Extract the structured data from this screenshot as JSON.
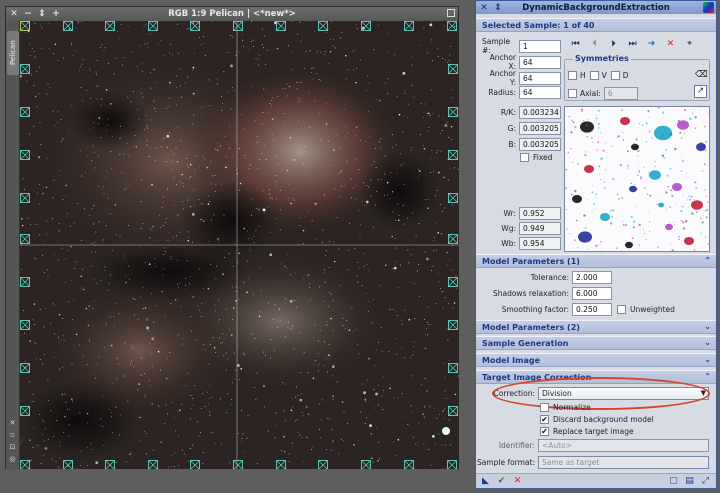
{
  "image_window": {
    "title": "RGB 1:9 Pelican | <*new*>",
    "side_tab": "Pelican",
    "controls": [
      "close-icon",
      "minimize-icon",
      "shade-icon",
      "maximize-icon"
    ]
  },
  "dbe": {
    "title": "DynamicBackgroundExtraction",
    "selected_sample": "Selected Sample: 1 of 40",
    "sample_label": "Sample #:",
    "sample_value": "1",
    "anchor_x_label": "Anchor X:",
    "anchor_x_value": "64",
    "anchor_y_label": "Anchor Y:",
    "anchor_y_value": "64",
    "radius_label": "Radius:",
    "radius_value": "64",
    "symmetries_title": "Symmetries",
    "sym_h": "H",
    "sym_v": "V",
    "sym_d": "D",
    "axial_label": "Axial:",
    "axial_value": "6",
    "rk_label": "R/K:",
    "rk_value": "0.003234",
    "g_label": "G:",
    "g_value": "0.003205",
    "b_label": "B:",
    "b_value": "0.003205",
    "fixed_label": "Fixed",
    "wr_label": "Wr:",
    "wr_value": "0.952",
    "wg_label": "Wg:",
    "wg_value": "0.949",
    "wb_label": "Wb:",
    "wb_value": "0.954",
    "sections": {
      "model_params_1": "Model Parameters (1)",
      "model_params_2": "Model Parameters (2)",
      "sample_generation": "Sample Generation",
      "model_image": "Model Image",
      "target_correction": "Target Image Correction"
    },
    "tolerance_label": "Tolerance:",
    "tolerance_value": "2.000",
    "shadows_label": "Shadows relaxation:",
    "shadows_value": "6.000",
    "smoothing_label": "Smoothing factor:",
    "smoothing_value": "0.250",
    "unweighted_label": "Unweighted",
    "correction_label": "Correction:",
    "correction_value": "Division",
    "normalize_label": "Normalize",
    "discard_label": "Discard background model",
    "replace_label": "Replace target image",
    "identifier_label": "Identifier:",
    "identifier_placeholder": "<Auto>",
    "sample_format_label": "Sample format:",
    "sample_format_value": "Same as target"
  },
  "colors": {
    "accent": "#1c3a84",
    "highlight_ring": "#d2452f",
    "panel_bg": "#d7dbe4"
  }
}
